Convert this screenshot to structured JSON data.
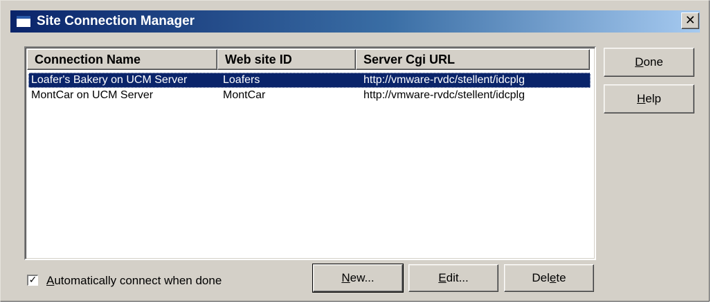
{
  "window": {
    "title": "Site Connection Manager",
    "close_glyph": "✕"
  },
  "list": {
    "columns": [
      "Connection Name",
      "Web site ID",
      "Server Cgi URL"
    ],
    "rows": [
      {
        "name": "Loafer's Bakery on UCM Server",
        "site_id": "Loafers",
        "url": "http://vmware-rvdc/stellent/idcplg",
        "selected": true
      },
      {
        "name": "MontCar on UCM Server",
        "site_id": "MontCar",
        "url": "http://vmware-rvdc/stellent/idcplg",
        "selected": false
      }
    ]
  },
  "side_buttons": {
    "done": {
      "mnemonic": "D",
      "rest": "one"
    },
    "help": {
      "mnemonic": "H",
      "rest": "elp"
    }
  },
  "bottom_buttons": {
    "new": {
      "mnemonic": "N",
      "rest": "ew..."
    },
    "edit": {
      "mnemonic": "E",
      "rest": "dit..."
    },
    "delete": {
      "pre": "Del",
      "mnemonic": "e",
      "rest": "te"
    }
  },
  "auto_connect": {
    "checked": true,
    "check_glyph": "✓",
    "mnemonic": "A",
    "rest": "utomatically connect when done"
  },
  "colors": {
    "selection": "#0a246a",
    "title_gradient_start": "#0a246a",
    "title_gradient_end": "#a6caf0",
    "face": "#d4d0c8"
  }
}
